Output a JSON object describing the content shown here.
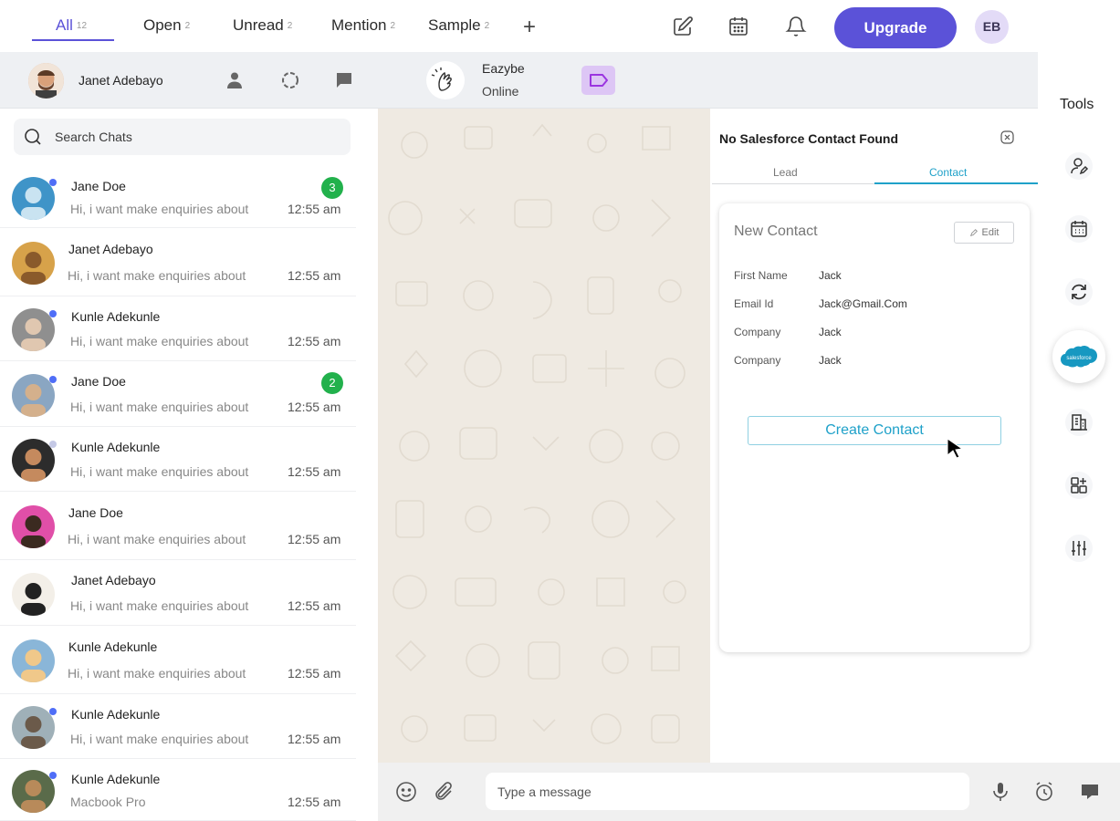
{
  "tabs": [
    {
      "label": "All",
      "count": "12"
    },
    {
      "label": "Open",
      "count": "2"
    },
    {
      "label": "Unread",
      "count": "2"
    },
    {
      "label": "Mention",
      "count": "2"
    },
    {
      "label": "Sample",
      "count": "2"
    }
  ],
  "topbar": {
    "upgrade_label": "Upgrade",
    "user_initials": "EB",
    "add_tab": "+"
  },
  "header": {
    "contact_name": "Janet Adebayo",
    "app_name": "Eazybe",
    "status": "Online"
  },
  "tools": {
    "title": "Tools"
  },
  "search": {
    "placeholder": "Search Chats"
  },
  "chats": [
    {
      "name": "Jane Doe",
      "message": "Hi, i want make enquiries about",
      "time": "12:55 am",
      "badge": "3"
    },
    {
      "name": "Janet Adebayo",
      "message": "Hi, i want make enquiries about",
      "time": "12:55 am",
      "badge": ""
    },
    {
      "name": "Kunle Adekunle",
      "message": "Hi, i want make enquiries about",
      "time": "12:55 am",
      "badge": ""
    },
    {
      "name": "Jane Doe",
      "message": "Hi, i want make enquiries about",
      "time": "12:55 am",
      "badge": "2"
    },
    {
      "name": "Kunle Adekunle",
      "message": "Hi, i want make enquiries about",
      "time": "12:55 am",
      "badge": ""
    },
    {
      "name": "Jane Doe",
      "message": "Hi, i want make enquiries about",
      "time": "12:55 am",
      "badge": ""
    },
    {
      "name": "Janet Adebayo",
      "message": "Hi, i want make enquiries about",
      "time": "12:55 am",
      "badge": ""
    },
    {
      "name": "Kunle Adekunle",
      "message": "Hi, i want make enquiries about",
      "time": "12:55 am",
      "badge": ""
    },
    {
      "name": "Kunle Adekunle",
      "message": "Hi, i want make enquiries about",
      "time": "12:55 am",
      "badge": ""
    },
    {
      "name": "Kunle Adekunle",
      "message": "Macbook Pro",
      "time": "12:55 am",
      "badge": ""
    }
  ],
  "salesforce": {
    "title": "No Salesforce Contact Found",
    "tabs": [
      "Lead",
      "Contact"
    ],
    "card_title": "New Contact",
    "edit_label": "Edit",
    "fields": [
      {
        "label": "First Name",
        "value": "Jack"
      },
      {
        "label": "Email Id",
        "value": "Jack@Gmail.Com"
      },
      {
        "label": "Company",
        "value": "Jack"
      },
      {
        "label": "Company",
        "value": "Jack"
      }
    ],
    "create_label": "Create Contact",
    "logo_text": "salesforce"
  },
  "composer": {
    "placeholder": "Type a message"
  },
  "colors": {
    "accent": "#5b52d8",
    "salesforce_blue": "#1fa1c9",
    "unread_badge": "#22b14c",
    "online_dot": "#4f6ef7"
  }
}
